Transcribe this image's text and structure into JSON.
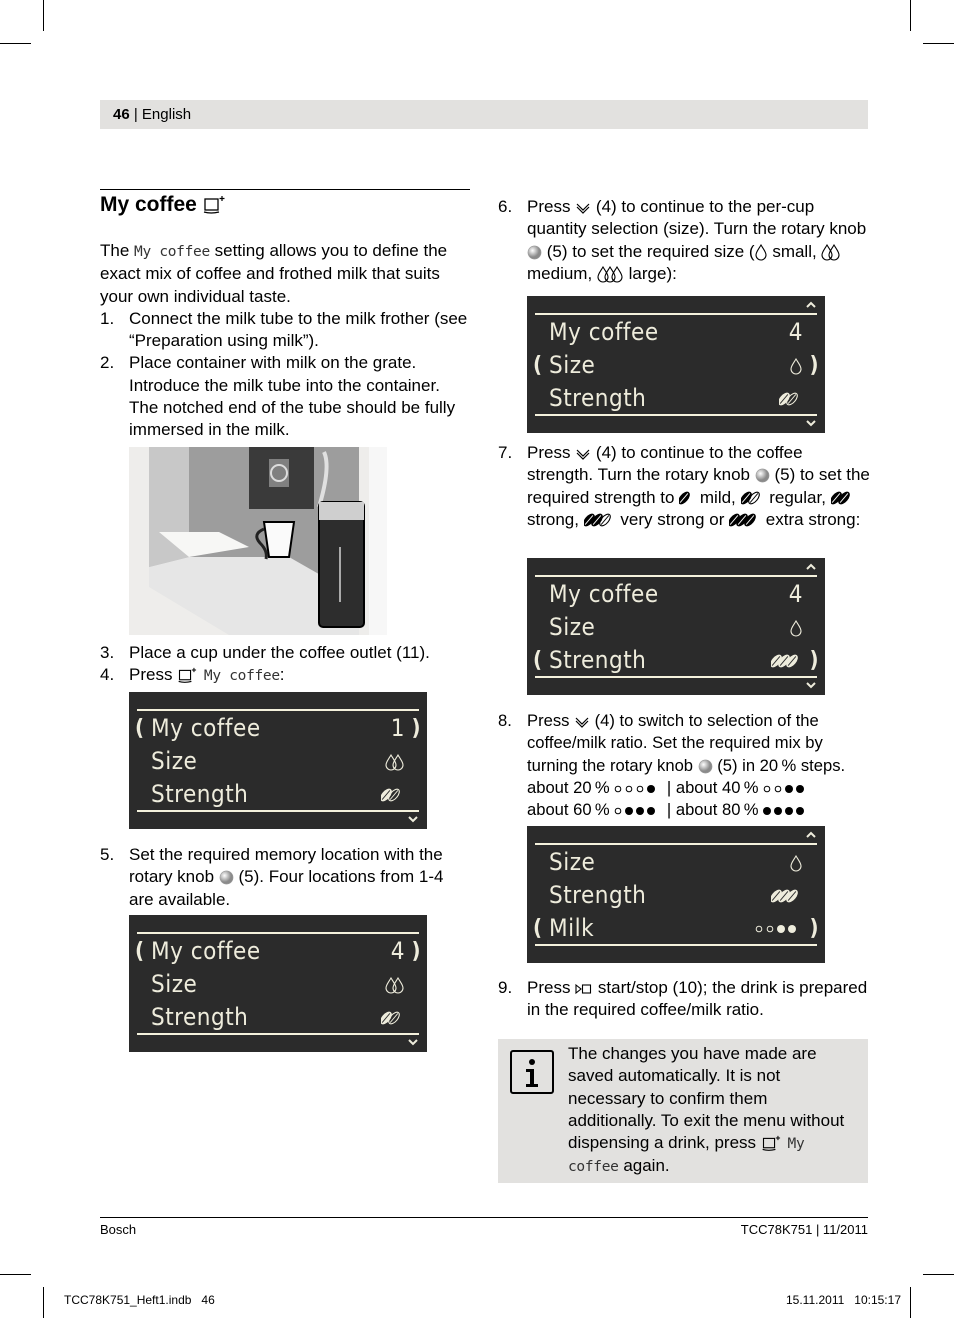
{
  "header": {
    "page_number": "46",
    "separator": " | ",
    "language": "English"
  },
  "section": {
    "title": "My coffee",
    "title_icon": "cup-plus-icon"
  },
  "intro": {
    "pre": "The ",
    "lcd_term": "My coffee",
    "post": " setting allows you to define the exact mix of coffee and frothed milk that suits your own individual taste."
  },
  "steps": [
    {
      "num": "1.",
      "text": "Connect the milk tube to the milk frother (see “Preparation using milk”)."
    },
    {
      "num": "2.",
      "text": "Place container with milk on the grate. Introduce the milk tube into the container. The notched end of the tube should be fully immersed in the milk."
    },
    {
      "num": "3.",
      "text": "Place a cup under the coffee outlet (11)."
    },
    {
      "num": "4.",
      "pre": "Press ",
      "lcd_term": "My coffee",
      "post": ":"
    },
    {
      "num": "5.",
      "pre": "Set the required memory location with the rotary knob ",
      "post": " (5). Four locations from 1-4 are available."
    },
    {
      "num": "6.",
      "pre": "Press ",
      "mid1": " (4) to continue to the per-cup quantity selection (size). Turn the rotary knob ",
      "mid2": " (5) to set the required size (",
      "small": " small, ",
      "medium": " medium, ",
      "large": " large):"
    },
    {
      "num": "7.",
      "pre": "Press ",
      "mid1": " (4) to continue to the coffee strength. Turn the rotary knob ",
      "mid2": " (5) to set the required strength to ",
      "mild": " mild, ",
      "regular": " regular, ",
      "strong": " strong, ",
      "very_strong": " very strong or ",
      "extra_strong": " extra strong:"
    },
    {
      "num": "8.",
      "pre": "Press ",
      "mid1": " (4) to switch to selection of the coffee/milk ratio. Set the required mix by turning the rotary knob ",
      "mid2": " (5) in 20 % steps.",
      "r20": "about 20 %",
      "r40": "| about 40 %",
      "r60": "about 60 %",
      "r80": "| about 80 %"
    },
    {
      "num": "9.",
      "pre": "Press ",
      "post": " start/stop (10); the drink is prepared in the required coffee/milk ratio."
    }
  ],
  "displays": [
    {
      "rows": [
        {
          "label": "My coffee",
          "value": "1",
          "selected": true
        },
        {
          "label": "Size",
          "value_icon": "size-medium",
          "selected": false
        },
        {
          "label": "Strength",
          "value_icon": "strength-regular",
          "selected": false
        }
      ],
      "up_arrow": false,
      "down_arrow": true
    },
    {
      "rows": [
        {
          "label": "My coffee",
          "value": "4",
          "selected": true
        },
        {
          "label": "Size",
          "value_icon": "size-medium",
          "selected": false
        },
        {
          "label": "Strength",
          "value_icon": "strength-regular",
          "selected": false
        }
      ],
      "up_arrow": false,
      "down_arrow": true
    },
    {
      "rows": [
        {
          "label": "My coffee",
          "value": "4",
          "selected": false
        },
        {
          "label": "Size",
          "value_icon": "size-small",
          "selected": true
        },
        {
          "label": "Strength",
          "value_icon": "strength-regular",
          "selected": false
        }
      ],
      "up_arrow": true,
      "down_arrow": true
    },
    {
      "rows": [
        {
          "label": "My coffee",
          "value": "4",
          "selected": false
        },
        {
          "label": "Size",
          "value_icon": "size-small",
          "selected": false
        },
        {
          "label": "Strength",
          "value_icon": "strength-extra-strong",
          "selected": true
        }
      ],
      "up_arrow": true,
      "down_arrow": true
    },
    {
      "rows": [
        {
          "label": "Size",
          "value_icon": "size-small",
          "selected": false
        },
        {
          "label": "Strength",
          "value_icon": "strength-extra-strong",
          "selected": false
        },
        {
          "label": "Milk",
          "value_icon": "milk-40",
          "selected": true
        }
      ],
      "up_arrow": true,
      "down_arrow": false
    }
  ],
  "info": {
    "icon": "info-icon",
    "text": "The changes you have made are saved automatically. It is not necessary to confirm them additionally. To exit the menu without dispensing a drink, press ",
    "lcd_term": "My coffee",
    "post": " again."
  },
  "footer": {
    "left": "Bosch",
    "right": "TCC78K751 | 11/2011"
  },
  "slug": {
    "left": "TCC78K751_Heft1.indb   46",
    "right": "15.11.2011   10:15:17"
  },
  "image": {
    "alt": "Coffee machine with cup under outlet and milk container"
  }
}
